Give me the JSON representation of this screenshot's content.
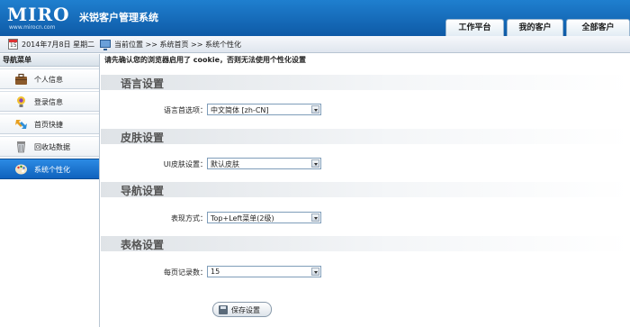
{
  "header": {
    "logo_text": "MIRO",
    "logo_sub": "www.mirocn.com",
    "app_title": "米锐客户管理系统",
    "tabs": [
      "工作平台",
      "我的客户",
      "全部客户"
    ]
  },
  "infobar": {
    "calendar_day": "15",
    "date": "2014年7月8日 星期二",
    "breadcrumb": "当前位置 >> 系统首页 >> 系统个性化"
  },
  "sidebar": {
    "title": "导航菜单",
    "items": [
      {
        "label": "个人信息",
        "icon": "briefcase-icon"
      },
      {
        "label": "登录信息",
        "icon": "lightbulb-icon"
      },
      {
        "label": "首页快捷",
        "icon": "shortcut-arrows-icon"
      },
      {
        "label": "回收站数据",
        "icon": "recycle-bin-icon"
      },
      {
        "label": "系统个性化",
        "icon": "palette-icon",
        "active": true
      }
    ]
  },
  "main": {
    "warning": "请先确认您的浏览器启用了 cookie，否则无法使用个性化设置",
    "sections": [
      {
        "title": "语言设置",
        "label": "语言首选项：",
        "value": "中文简体 [zh-CN]"
      },
      {
        "title": "皮肤设置",
        "label": "UI皮肤设置：",
        "value": "默认皮肤"
      },
      {
        "title": "导航设置",
        "label": "表现方式：",
        "value": "Top+Left菜单(2级)"
      },
      {
        "title": "表格设置",
        "label": "每页记录数：",
        "value": "15"
      }
    ],
    "save_label": "保存设置"
  },
  "colors": {
    "header": "#1672c4",
    "active_item": "#1a74d2",
    "logo_accent": "#e23a2c"
  }
}
